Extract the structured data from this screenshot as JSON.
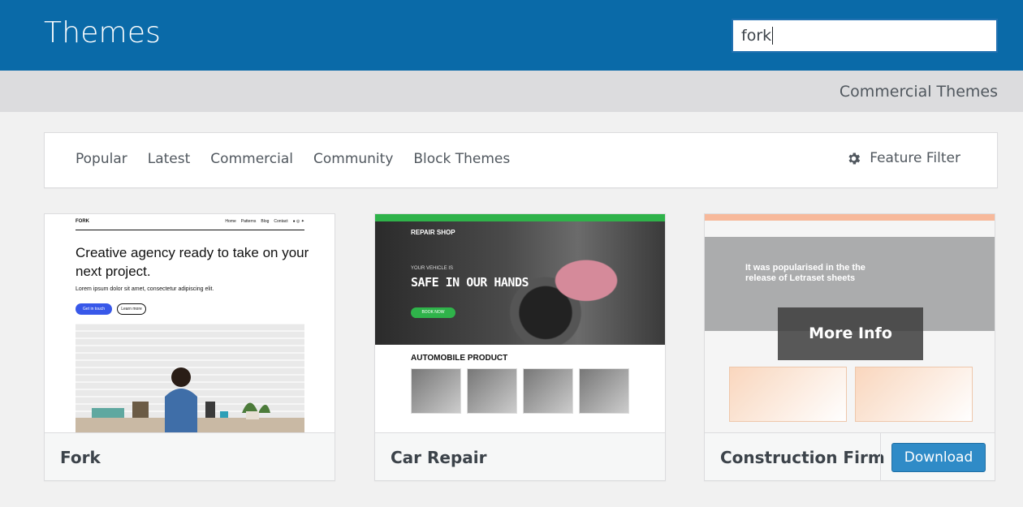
{
  "header": {
    "title": "Themes",
    "search_value": "fork"
  },
  "subband": {
    "commercial_link": "Commercial Themes"
  },
  "filterbar": {
    "tabs": [
      "Popular",
      "Latest",
      "Commercial",
      "Community",
      "Block Themes"
    ],
    "feature_filter": "Feature Filter"
  },
  "themes": [
    {
      "name": "Fork",
      "preview": {
        "brand": "FORK",
        "nav_links": [
          "Home",
          "Patterns",
          "Blog",
          "Contact"
        ],
        "headline": "Creative agency ready to take on your next project.",
        "body": "Lorem ipsum dolor sit amet, consectetur adipiscing elit.",
        "primary_button": "Get in touch",
        "secondary_button": "Learn more"
      }
    },
    {
      "name": "Car Repair",
      "preview": {
        "logo": "REPAIR SHOP",
        "kicker": "YOUR VEHICLE IS",
        "headline": "SAFE IN OUR HANDS",
        "cta": "BOOK NOW",
        "section_title": "AUTOMOBILE PRODUCT"
      }
    },
    {
      "name": "Construction Firm",
      "preview": {
        "headline": "It was popularised in the the release of Letraset sheets"
      },
      "overlay_label": "More Info",
      "download_label": "Download"
    }
  ],
  "colors": {
    "header_bg": "#0a6aa8",
    "accent": "#2f8bc7"
  }
}
